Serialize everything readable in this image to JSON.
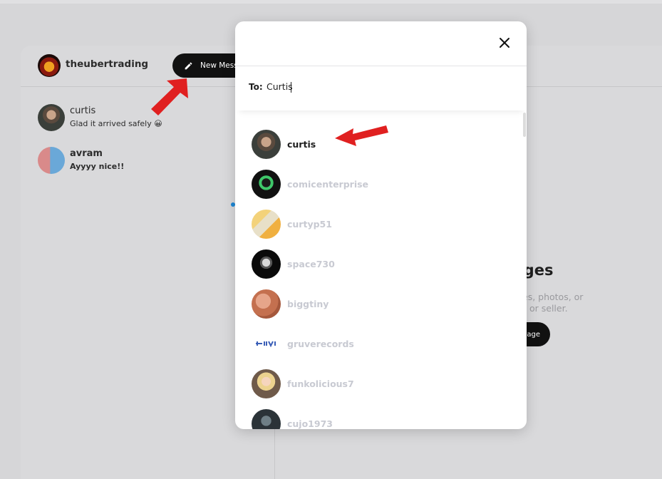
{
  "header": {
    "username": "theubertrading",
    "new_message_label": "New Mess"
  },
  "conversations": [
    {
      "name": "curtis",
      "preview": "Glad it arrived safely 😀",
      "unread": false
    },
    {
      "name": "avram",
      "preview": "Ayyyy nice!!",
      "unread": true
    }
  ],
  "empty_state": {
    "title": "sages",
    "line1": "es, photos, or",
    "line2": "or seller.",
    "button_label": "sage"
  },
  "modal": {
    "to_label": "To:",
    "search_value": "Curtis",
    "results": [
      {
        "name": "curtis"
      },
      {
        "name": "comicenterprise"
      },
      {
        "name": "curtyp51"
      },
      {
        "name": "space730"
      },
      {
        "name": "biggtiny"
      },
      {
        "name": "gruverecords"
      },
      {
        "name": "funkolicious7"
      },
      {
        "name": "cujo1973"
      }
    ]
  },
  "icons": {
    "pencil": "pencil-icon",
    "close": "close-icon",
    "annotation_arrow": "red-arrow"
  },
  "colors": {
    "accent_dark": "#111111",
    "unread_dot": "#1e88d6",
    "annotation_red": "#e02020",
    "inactive_name": "#c8cad2"
  }
}
